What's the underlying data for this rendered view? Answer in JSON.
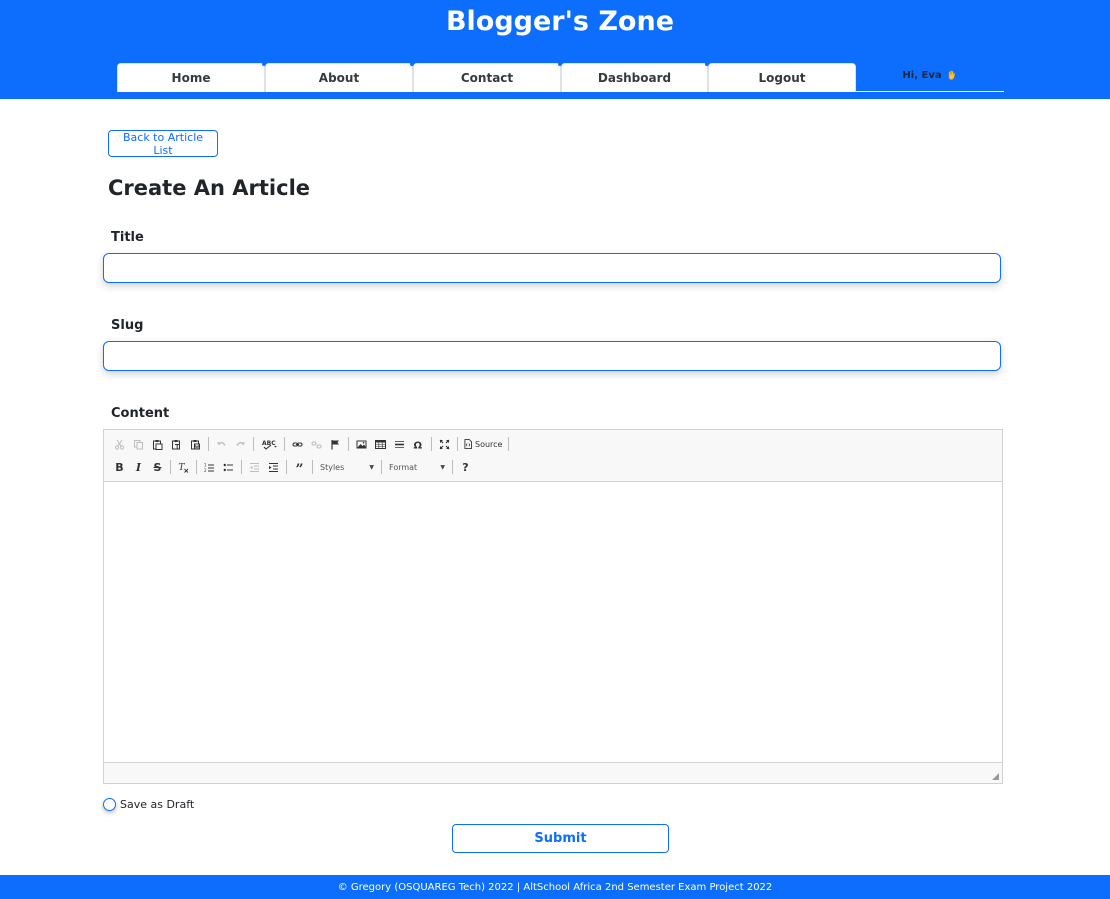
{
  "header": {
    "title": "Blogger's Zone",
    "nav": {
      "home": "Home",
      "about": "About",
      "contact": "Contact",
      "dashboard": "Dashboard",
      "logout": "Logout"
    },
    "greeting": "Hi, Eva"
  },
  "main": {
    "back_button": "Back to Article List",
    "page_title": "Create An Article",
    "title_field": {
      "label": "Title",
      "value": "",
      "placeholder": ""
    },
    "slug_field": {
      "label": "Slug",
      "value": "",
      "placeholder": ""
    },
    "content_label": "Content",
    "editor": {
      "source_label": "Source",
      "styles_combo": "Styles",
      "format_combo": "Format",
      "help_label": "?"
    },
    "draft_label": "Save as Draft",
    "submit_label": "Submit"
  },
  "footer": {
    "text": "© Gregory (OSQUAREG Tech) 2022 | AltSchool Africa 2nd Semester Exam Project 2022"
  },
  "colors": {
    "primary": "#0d6efd",
    "white": "#ffffff",
    "text": "#212529"
  }
}
